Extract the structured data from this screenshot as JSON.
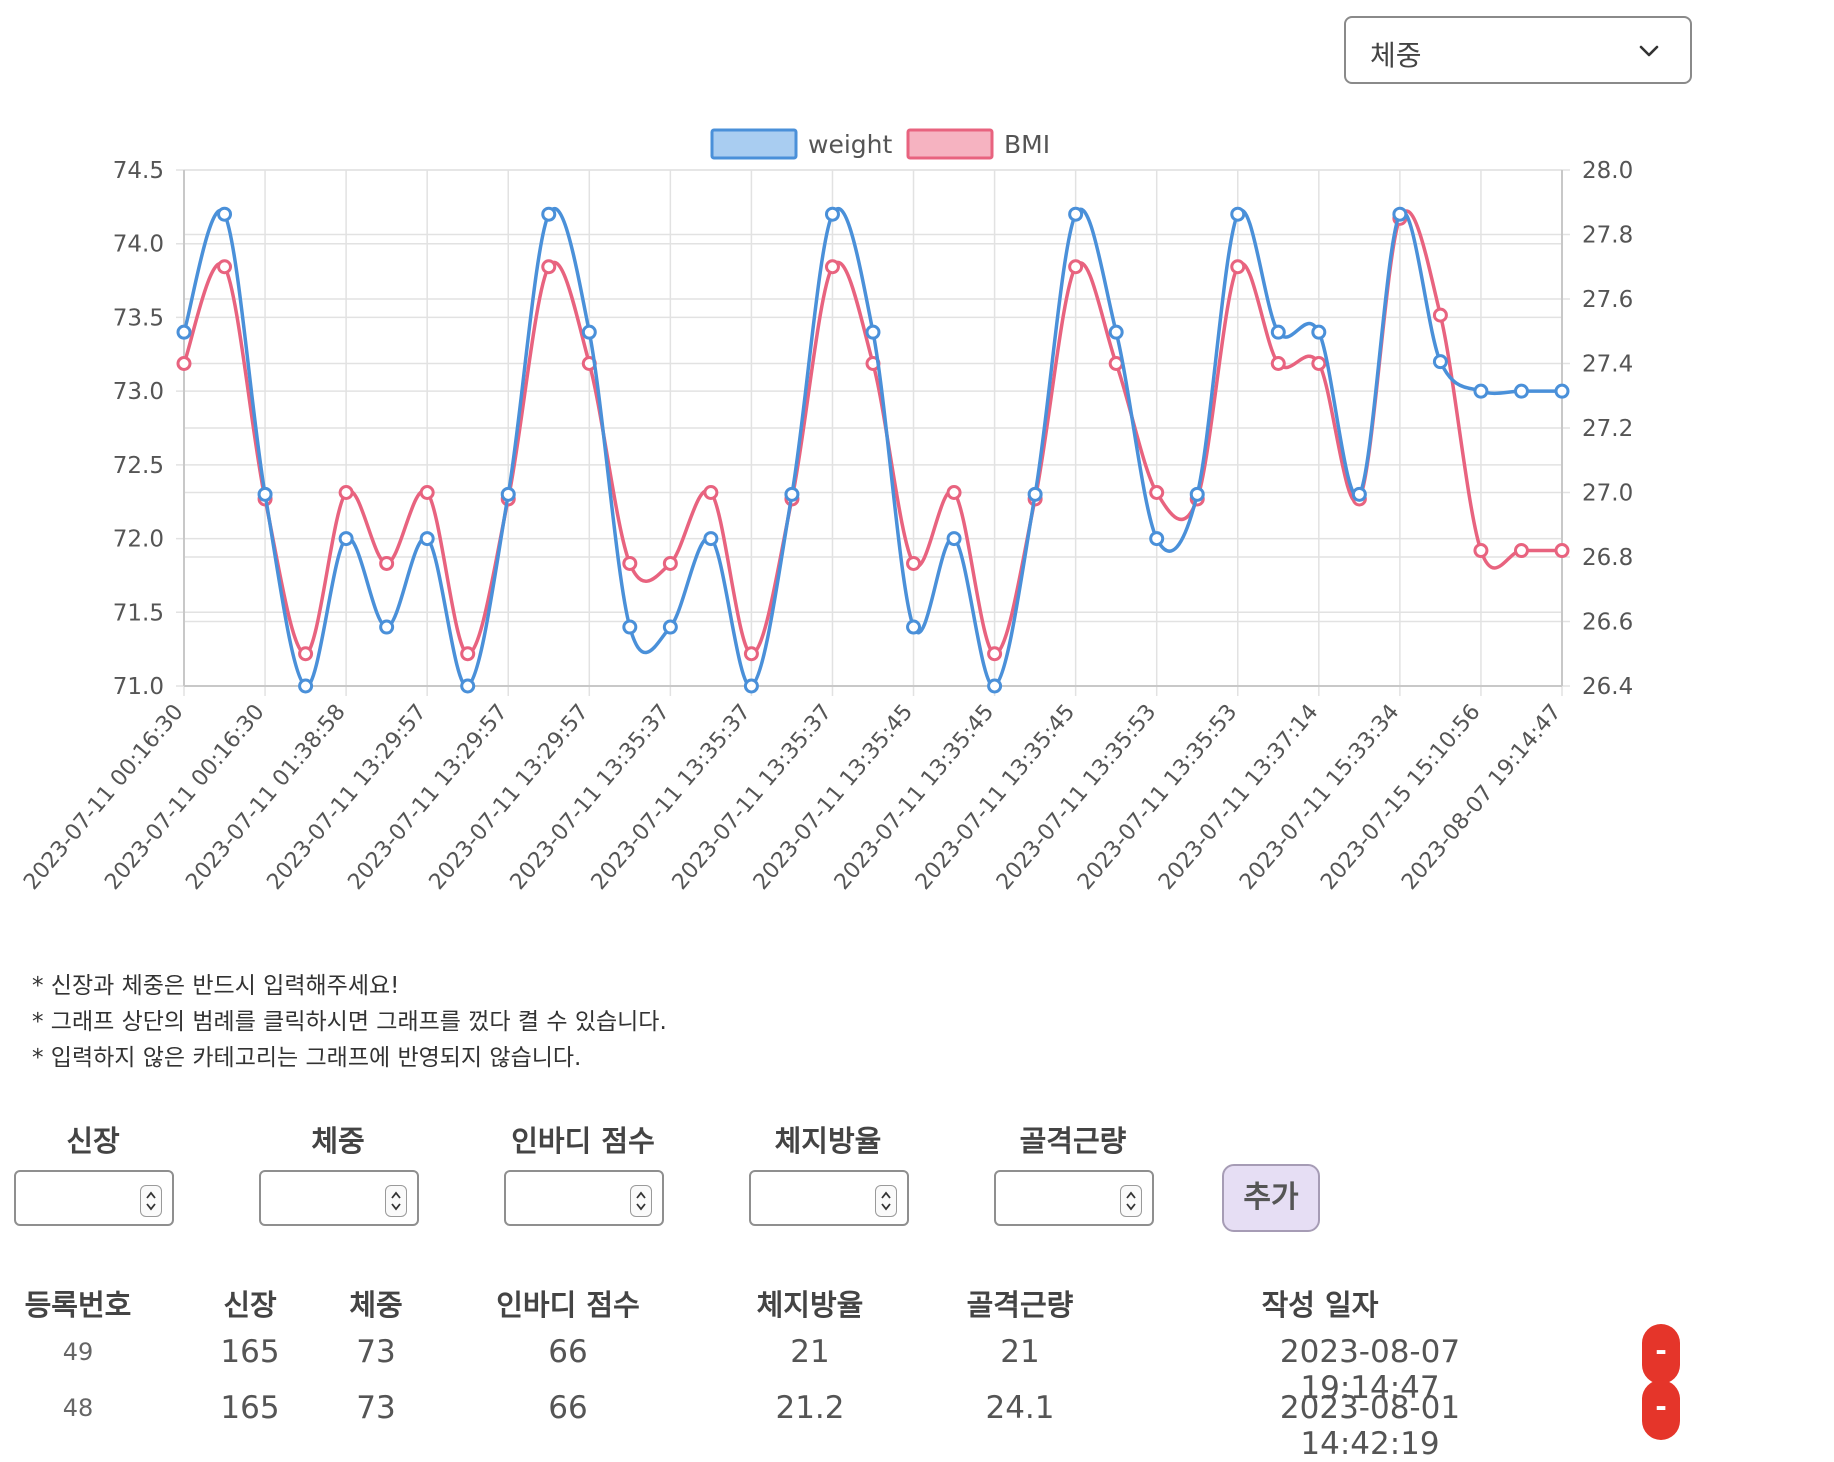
{
  "category_select": {
    "selected": "체중"
  },
  "chart_data": {
    "type": "line",
    "categories": [
      "2023-07-11 00:16:30",
      "2023-07-11 00:16:30",
      "2023-07-11 01:38:58",
      "2023-07-11 13:29:57",
      "2023-07-11 13:29:57",
      "2023-07-11 13:29:57",
      "2023-07-11 13:35:37",
      "2023-07-11 13:35:37",
      "2023-07-11 13:35:37",
      "2023-07-11 13:35:45",
      "2023-07-11 13:35:45",
      "2023-07-11 13:35:45",
      "2023-07-11 13:35:53",
      "2023-07-11 13:35:53",
      "2023-07-11 13:37:14",
      "2023-07-11 15:33:34",
      "2023-07-15 15:10:56",
      "2023-08-07 19:14:47"
    ],
    "series": [
      {
        "name": "weight",
        "axis": "left",
        "color": "#4a90d9",
        "fill": "#a9cdf1",
        "values": [
          73.4,
          74.2,
          72.3,
          71.0,
          72.0,
          71.4,
          72.0,
          71.0,
          72.3,
          74.2,
          73.4,
          71.4,
          71.4,
          72.0,
          71.0,
          72.3,
          74.2,
          73.4,
          71.4,
          72.0,
          71.0,
          72.3,
          74.2,
          73.4,
          72.0,
          72.3,
          74.2,
          73.4,
          73.4,
          72.3,
          74.2,
          73.2,
          73.0,
          73.0,
          73.0
        ]
      },
      {
        "name": "BMI",
        "axis": "right",
        "color": "#e8637f",
        "fill": "#f6b3c1",
        "values": [
          27.4,
          27.7,
          26.98,
          26.5,
          27.0,
          26.78,
          27.0,
          26.5,
          26.98,
          27.7,
          27.4,
          26.78,
          26.78,
          27.0,
          26.5,
          26.98,
          27.7,
          27.4,
          26.78,
          27.0,
          26.5,
          26.98,
          27.7,
          27.4,
          27.0,
          26.98,
          27.7,
          27.4,
          27.4,
          26.98,
          27.85,
          27.55,
          26.82,
          26.82,
          26.82
        ]
      }
    ],
    "y_left": {
      "min": 71.0,
      "max": 74.5,
      "ticks": [
        "74.5",
        "74.0",
        "73.5",
        "73.0",
        "72.5",
        "72.0",
        "71.5",
        "71.0"
      ]
    },
    "y_right": {
      "min": 26.4,
      "max": 28.0,
      "ticks": [
        "28.0",
        "27.8",
        "27.6",
        "27.4",
        "27.2",
        "27.0",
        "26.8",
        "26.6",
        "26.4"
      ]
    },
    "legend_position": "top",
    "grid": true
  },
  "notes": [
    "* 신장과 체중은 반드시 입력해주세요!",
    "* 그래프 상단의 범례를 클릭하시면 그래프를 껐다 켤 수 있습니다.",
    "* 입력하지 않은 카테고리는 그래프에 반영되지 않습니다."
  ],
  "inputs": {
    "height": "신장",
    "weight": "체중",
    "inbody": "인바디 점수",
    "fat": "체지방율",
    "muscle": "골격근량",
    "add_label": "추가"
  },
  "table": {
    "headers": [
      "등록번호",
      "신장",
      "체중",
      "인바디 점수",
      "체지방율",
      "골격근량",
      "작성 일자"
    ],
    "rows": [
      {
        "id": "49",
        "height": "165",
        "weight": "73",
        "inbody": "66",
        "fat": "21",
        "muscle": "21",
        "date": "2023-08-07 19:14:47",
        "del": "-"
      },
      {
        "id": "48",
        "height": "165",
        "weight": "73",
        "inbody": "66",
        "fat": "21.2",
        "muscle": "24.1",
        "date": "2023-08-01 14:42:19",
        "del": "-"
      }
    ]
  }
}
